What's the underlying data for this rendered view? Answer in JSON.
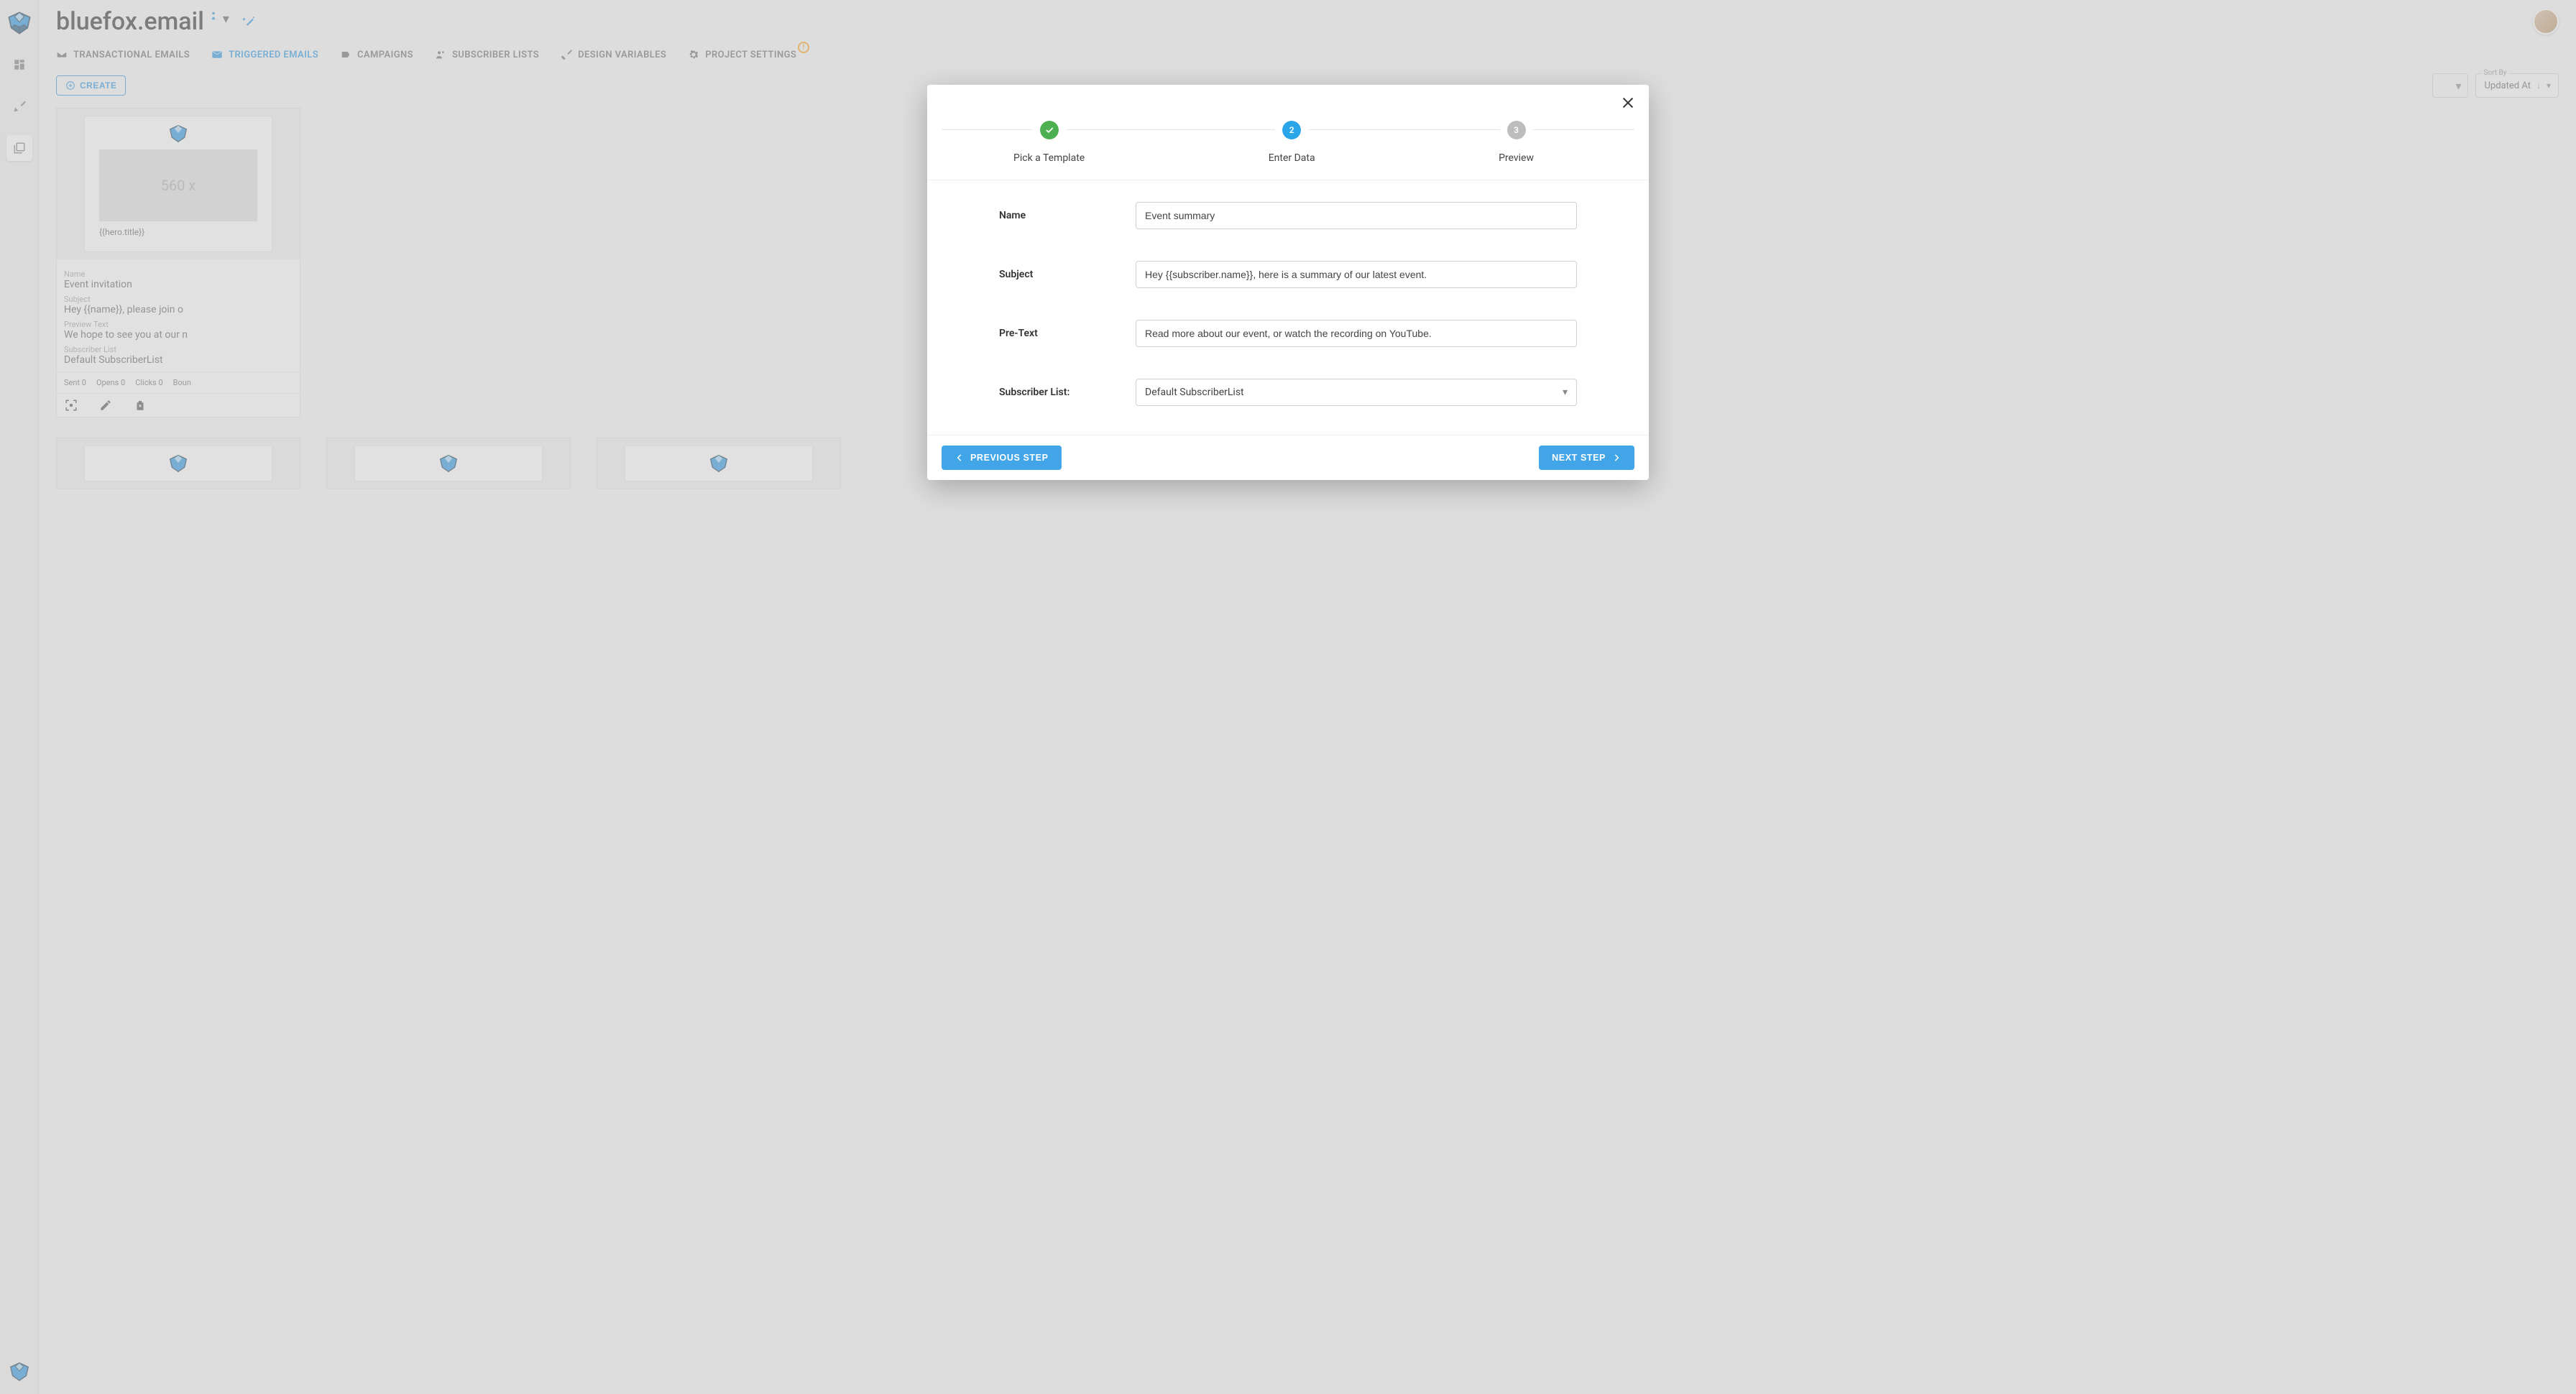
{
  "brand": "bluefox.email",
  "tabs": {
    "transactional": "TRANSACTIONAL EMAILS",
    "triggered": "TRIGGERED EMAILS",
    "campaigns": "CAMPAIGNS",
    "subscriber_lists": "SUBSCRIBER LISTS",
    "design_variables": "DESIGN VARIABLES",
    "project_settings": "PROJECT SETTINGS"
  },
  "create_label": "CREATE",
  "sort": {
    "label": "Sort By",
    "value": "Updated At",
    "direction": "↓"
  },
  "card": {
    "placeholder": "560 x",
    "hero_title": "{{hero.title}}",
    "name_label": "Name",
    "name": "Event invitation",
    "subject_label": "Subject",
    "subject": "Hey {{name}}, please join o",
    "preview_label": "Preview Text",
    "preview": "We hope to see you at our n",
    "list_label": "Subscriber List",
    "list": "Default SubscriberList",
    "sent": "Sent 0",
    "opens": "Opens 0",
    "clicks": "Clicks 0",
    "bounces": "Boun"
  },
  "modal": {
    "steps": {
      "s1": "Pick a Template",
      "s2": "Enter Data",
      "s3": "Preview",
      "n2": "2",
      "n3": "3"
    },
    "form": {
      "name_label": "Name",
      "name_value": "Event summary",
      "subject_label": "Subject",
      "subject_value": "Hey {{subscriber.name}}, here is a summary of our latest event.",
      "pretext_label": "Pre-Text",
      "pretext_value": "Read more about our event, or watch the recording on YouTube.",
      "list_label": "Subscriber List:",
      "list_value": "Default SubscriberList"
    },
    "prev": "PREVIOUS STEP",
    "next": "NEXT STEP"
  }
}
